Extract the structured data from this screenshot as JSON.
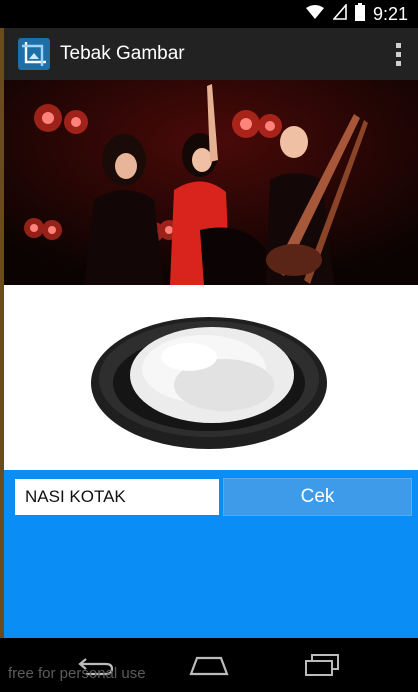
{
  "status_bar": {
    "time": "9:21",
    "icons": [
      "wifi-icon",
      "signal-icon",
      "battery-icon"
    ]
  },
  "action_bar": {
    "title": "Tebak Gambar",
    "app_icon": "crop-icon",
    "overflow_icon": "overflow-menu-icon"
  },
  "puzzle": {
    "image_1": "concert-photo",
    "image_2": "rice-plate-photo"
  },
  "answer": {
    "input_value": "NASI KOTAK",
    "check_label": "Cek"
  },
  "nav_bar": {
    "icons": [
      "back-icon",
      "home-icon",
      "recents-icon"
    ]
  },
  "watermark": "free for personal use",
  "colors": {
    "action_bar": "#222222",
    "answer_panel": "#0a8ef5",
    "check_button": "#3e9be9"
  }
}
